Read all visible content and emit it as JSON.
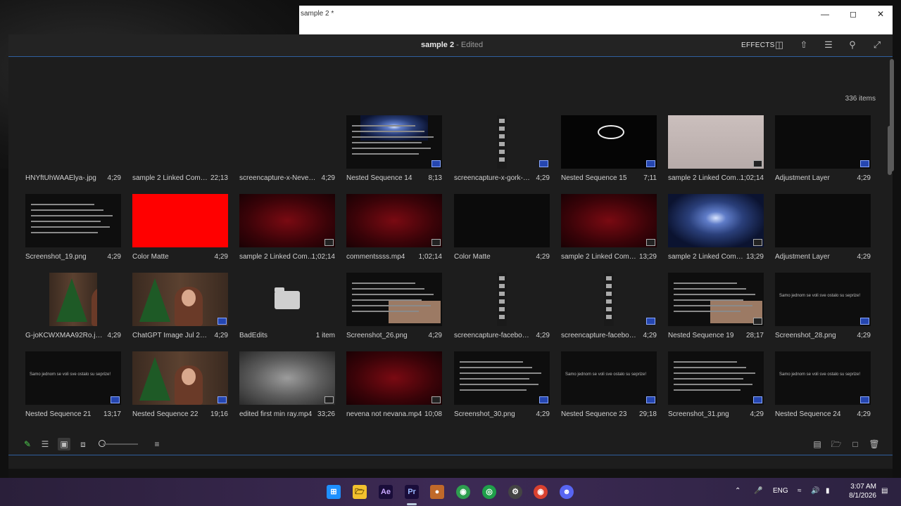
{
  "window": {
    "title": "sample 2 *"
  },
  "header": {
    "doc_name": "sample 2",
    "doc_sep": " - ",
    "doc_status": "Edited",
    "effects_label": "EFFECTS"
  },
  "project": {
    "item_count": "336 items"
  },
  "rows": [
    [
      {
        "name": "HNYftUhWAAElya-.jpg",
        "dur": "4;29",
        "thumb": "hidden"
      },
      {
        "name": "sample 2 Linked Comp 0...",
        "dur": "22;13",
        "thumb": "hidden"
      },
      {
        "name": "screencapture-x-NevenaC...",
        "dur": "4;29",
        "thumb": "hidden"
      },
      {
        "name": "Nested Sequence 14",
        "dur": "8;13",
        "thumb": "tweet-galaxy",
        "badge": "seq"
      },
      {
        "name": "screencapture-x-gork-202...",
        "dur": "4;29",
        "thumb": "strip",
        "badge": "seq"
      },
      {
        "name": "Nested Sequence 15",
        "dur": "7;11",
        "thumb": "doodle",
        "badge": "seq"
      },
      {
        "name": "sample 2 Linked Comp...",
        "dur": "1;02;14",
        "thumb": "gray",
        "badge": "linked"
      },
      {
        "name": "Adjustment Layer",
        "dur": "4;29",
        "thumb": "black",
        "badge": "seq"
      }
    ],
    [
      {
        "name": "Screenshot_19.png",
        "dur": "4;29",
        "thumb": "tweet"
      },
      {
        "name": "Color Matte",
        "dur": "4;29",
        "thumb": "red"
      },
      {
        "name": "sample 2 Linked Comp...",
        "dur": "1;02;14",
        "thumb": "darkred",
        "badge": "linked"
      },
      {
        "name": "commentssss.mp4",
        "dur": "1;02;14",
        "thumb": "darkred",
        "badge": "linked"
      },
      {
        "name": "Color Matte",
        "dur": "4;29",
        "thumb": "black"
      },
      {
        "name": "sample 2 Linked Comp 0...",
        "dur": "13;29",
        "thumb": "darkred",
        "badge": "linked"
      },
      {
        "name": "sample 2 Linked Comp 0...",
        "dur": "13;29",
        "thumb": "galaxy",
        "badge": "linked"
      },
      {
        "name": "Adjustment Layer",
        "dur": "4;29",
        "thumb": "black"
      }
    ],
    [
      {
        "name": "G-joKCWXMAA92Ro.jpg",
        "dur": "4;29",
        "thumb": "tree-small"
      },
      {
        "name": "ChatGPT Image Jul 20, 20...",
        "dur": "4;29",
        "thumb": "tree",
        "badge": "seq"
      },
      {
        "name": "BadEdits",
        "dur": "1 item",
        "thumb": "folder"
      },
      {
        "name": "Screenshot_26.png",
        "dur": "4;29",
        "thumb": "tweet-photo"
      },
      {
        "name": "screencapture-facebook-n...",
        "dur": "4;29",
        "thumb": "strip"
      },
      {
        "name": "screencapture-facebook-n...",
        "dur": "4;29",
        "thumb": "strip",
        "badge": "seq"
      },
      {
        "name": "Nested Sequence 19",
        "dur": "28;17",
        "thumb": "tweet-photo",
        "badge": "linked"
      },
      {
        "name": "Screenshot_28.png",
        "dur": "4;29",
        "thumb": "caption",
        "badge": "seq"
      }
    ],
    [
      {
        "name": "Nested Sequence 21",
        "dur": "13;17",
        "thumb": "caption",
        "badge": "seq"
      },
      {
        "name": "Nested Sequence 22",
        "dur": "19;16",
        "thumb": "tree",
        "badge": "seq"
      },
      {
        "name": "edited first min ray.mp4",
        "dur": "33;26",
        "thumb": "fog",
        "badge": "linked"
      },
      {
        "name": "nevena not nevana.mp4",
        "dur": "10;08",
        "thumb": "darkred",
        "badge": "linked"
      },
      {
        "name": "Screenshot_30.png",
        "dur": "4;29",
        "thumb": "tweet",
        "badge": "seq"
      },
      {
        "name": "Nested Sequence 23",
        "dur": "29;18",
        "thumb": "caption",
        "badge": "seq"
      },
      {
        "name": "Screenshot_31.png",
        "dur": "4;29",
        "thumb": "tweet",
        "badge": "seq"
      },
      {
        "name": "Nested Sequence 24",
        "dur": "4;29",
        "thumb": "caption",
        "badge": "seq"
      }
    ]
  ],
  "thumb_texts": {
    "caption": "Samo jednom se voli sve ostalo su seprize!"
  },
  "taskbar": {
    "lang": "ENG",
    "time": "3:07 AM",
    "date": "8/1/2026",
    "apps": [
      "windows-start",
      "file-explorer",
      "after-effects",
      "premiere-pro",
      "app-orange",
      "chrome",
      "app-green",
      "app-gray",
      "chrome-2",
      "discord"
    ],
    "app_labels": {
      "ae": "Ae",
      "pr": "Pr"
    }
  },
  "colors": {
    "accent": "#2f5f9f",
    "premiere_blue": "#2546b0"
  }
}
